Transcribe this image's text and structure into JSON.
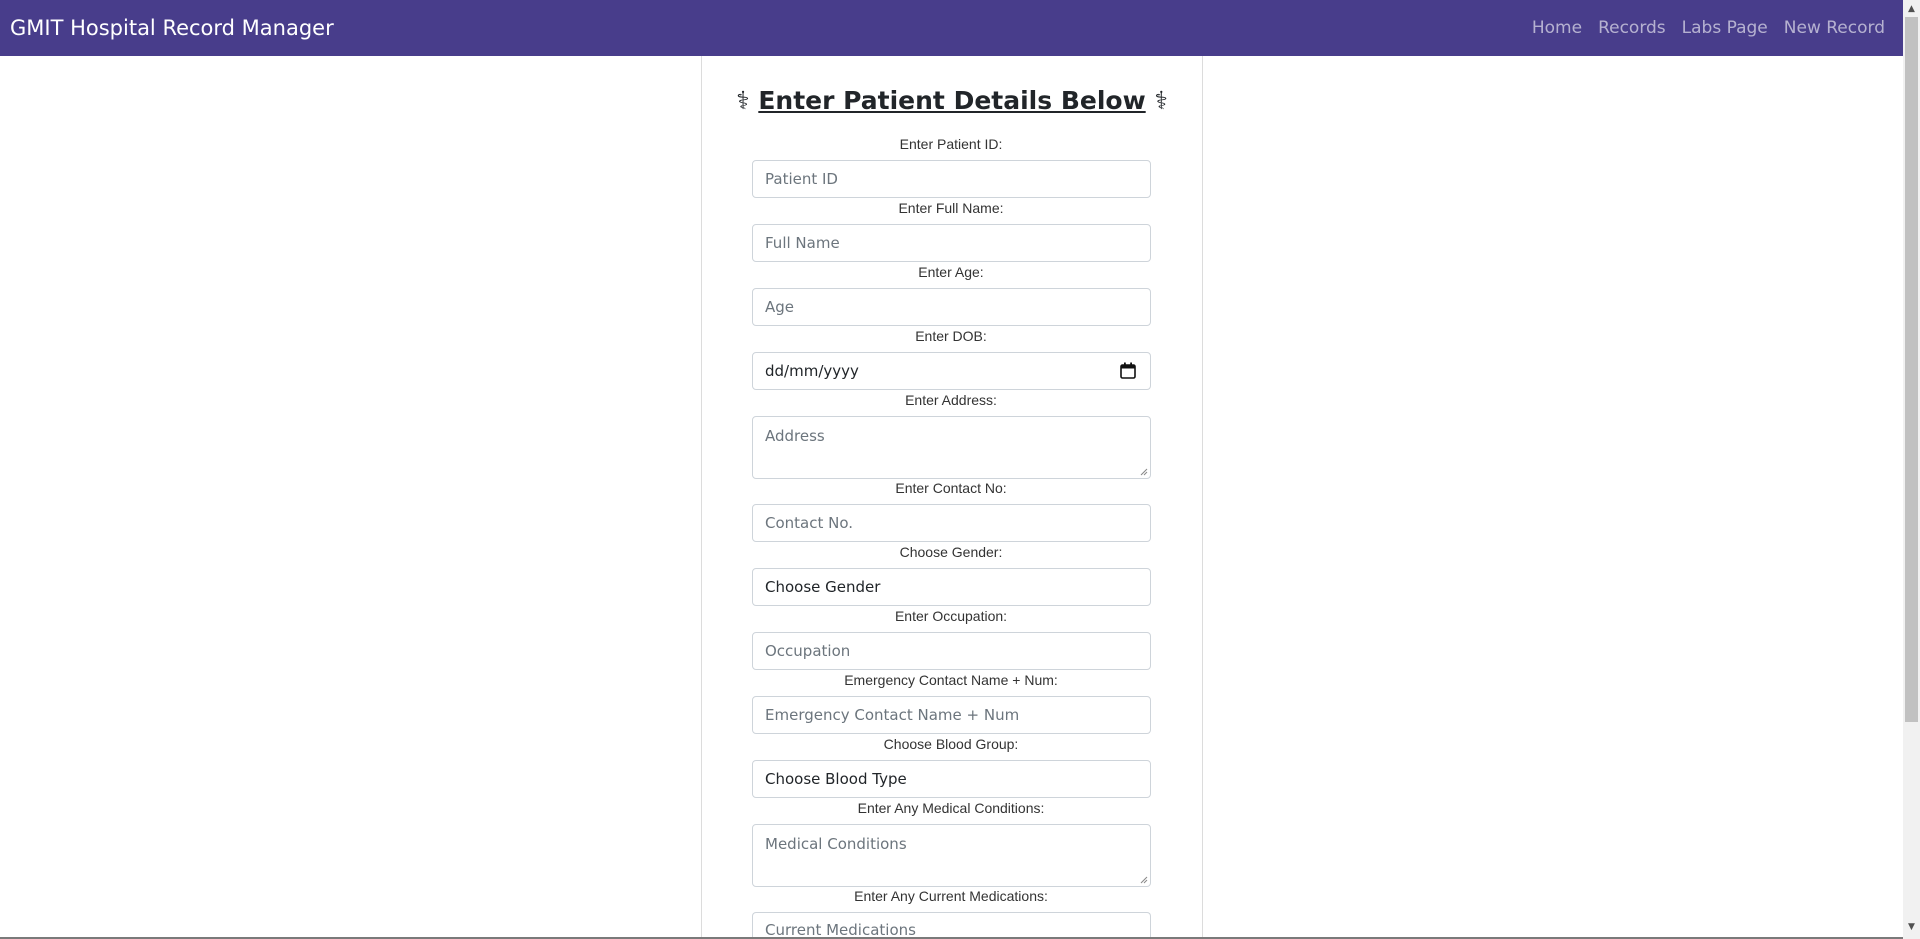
{
  "navbar": {
    "brand": "GMIT Hospital Record Manager",
    "links": [
      "Home",
      "Records",
      "Labs Page",
      "New Record"
    ]
  },
  "form": {
    "title_icon": "⚕",
    "title": "Enter Patient Details Below",
    "fields": [
      {
        "label": "Enter Patient ID:",
        "placeholder": "Patient ID"
      },
      {
        "label": "Enter Full Name:",
        "placeholder": "Full Name"
      },
      {
        "label": "Enter Age:",
        "placeholder": "Age"
      },
      {
        "label": "Enter DOB:",
        "value": "dd/mm/yyyy"
      },
      {
        "label": "Enter Address:",
        "placeholder": "Address"
      },
      {
        "label": "Enter Contact No:",
        "placeholder": "Contact No."
      },
      {
        "label": "Choose Gender:",
        "value": "Choose Gender"
      },
      {
        "label": "Enter Occupation:",
        "placeholder": "Occupation"
      },
      {
        "label": "Emergency Contact Name + Num:",
        "placeholder": "Emergency Contact Name + Num"
      },
      {
        "label": "Choose Blood Group:",
        "value": "Choose Blood Type"
      },
      {
        "label": "Enter Any Medical Conditions:",
        "placeholder": "Medical Conditions"
      },
      {
        "label": "Enter Any Current Medications:",
        "placeholder": "Current Medications"
      }
    ]
  },
  "colors": {
    "navbar_bg": "#483d8b",
    "nav_link": "rgba(255,255,255,0.6)",
    "placeholder": "#6c757d"
  },
  "icons": {
    "title": "medical-caduceus-icon",
    "date": "calendar-icon"
  }
}
